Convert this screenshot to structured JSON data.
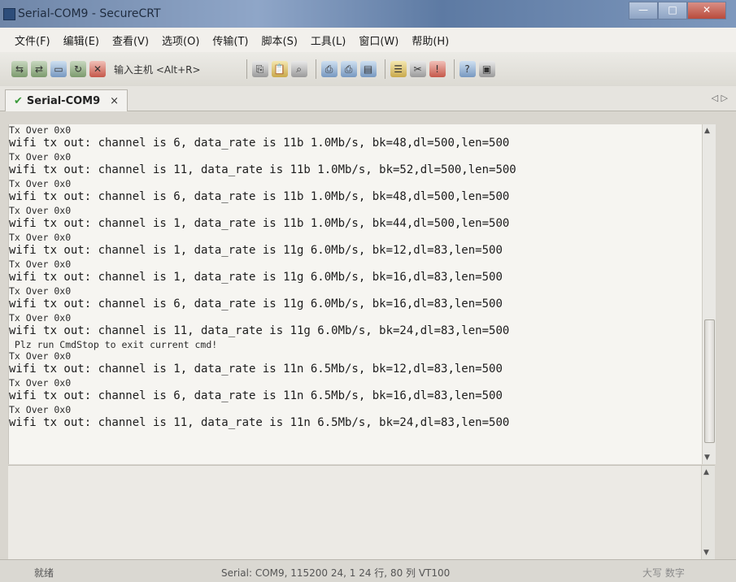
{
  "window": {
    "title": "Serial-COM9 - SecureCRT",
    "buttons": [
      "—",
      "□",
      "✕"
    ]
  },
  "menu": [
    "文件(F)",
    "编辑(E)",
    "查看(V)",
    "选项(O)",
    "传输(T)",
    "脚本(S)",
    "工具(L)",
    "窗口(W)",
    "帮助(H)"
  ],
  "toolbar": {
    "quick_connect": "输入主机 <Alt+R>",
    "icons_left": [
      "connect-icon",
      "quick-connect-icon",
      "connect-tab-icon",
      "reconnect-icon",
      "disconnect-icon"
    ],
    "icons_right": [
      "copy-icon",
      "paste-icon",
      "find-icon",
      "print-icon",
      "print-setup-icon",
      "log-icon",
      "session-options-icon",
      "keymap-icon",
      "tips-icon",
      "help-icon",
      "terminal-icon"
    ]
  },
  "tab": {
    "label": "Serial-COM9",
    "close": "×",
    "arrows": "◁ ▷"
  },
  "terminal": {
    "lines": [
      {
        "t": "Tx Over 0x0",
        "k": "small"
      },
      {
        "t": "wifi tx out: channel is 6, data_rate is 11b 1.0Mb/s, bk=48,dl=500,len=500",
        "k": "big"
      },
      {
        "t": "Tx Over 0x0",
        "k": "small"
      },
      {
        "t": "wifi tx out: channel is 11, data_rate is 11b 1.0Mb/s, bk=52,dl=500,len=500",
        "k": "big"
      },
      {
        "t": "Tx Over 0x0",
        "k": "small"
      },
      {
        "t": "wifi tx out: channel is 6, data_rate is 11b 1.0Mb/s, bk=48,dl=500,len=500",
        "k": "big"
      },
      {
        "t": "Tx Over 0x0",
        "k": "small"
      },
      {
        "t": "wifi tx out: channel is 1, data_rate is 11b 1.0Mb/s, bk=44,dl=500,len=500",
        "k": "big"
      },
      {
        "t": "Tx Over 0x0",
        "k": "small"
      },
      {
        "t": "wifi tx out: channel is 1, data_rate is 11g 6.0Mb/s, bk=12,dl=83,len=500",
        "k": "big"
      },
      {
        "t": "Tx Over 0x0",
        "k": "small"
      },
      {
        "t": "wifi tx out: channel is 1, data_rate is 11g 6.0Mb/s, bk=16,dl=83,len=500",
        "k": "big"
      },
      {
        "t": "Tx Over 0x0",
        "k": "small"
      },
      {
        "t": "wifi tx out: channel is 6, data_rate is 11g 6.0Mb/s, bk=16,dl=83,len=500",
        "k": "big"
      },
      {
        "t": "Tx Over 0x0",
        "k": "small"
      },
      {
        "t": "wifi tx out: channel is 11, data_rate is 11g 6.0Mb/s, bk=24,dl=83,len=500",
        "k": "big"
      },
      {
        "t": " Plz run CmdStop to exit current cmd!",
        "k": "small"
      },
      {
        "t": "Tx Over 0x0",
        "k": "small"
      },
      {
        "t": "wifi tx out: channel is 1, data_rate is 11n 6.5Mb/s, bk=12,dl=83,len=500",
        "k": "big"
      },
      {
        "t": "Tx Over 0x0",
        "k": "small"
      },
      {
        "t": "wifi tx out: channel is 6, data_rate is 11n 6.5Mb/s, bk=16,dl=83,len=500",
        "k": "big"
      },
      {
        "t": "Tx Over 0x0",
        "k": "small"
      },
      {
        "t": "wifi tx out: channel is 11, data_rate is 11n 6.5Mb/s, bk=24,dl=83,len=500",
        "k": "big"
      }
    ]
  },
  "status": {
    "ready": "就绪",
    "session": "Serial: COM9, 115200   24,  1   24 行, 80 列  VT100",
    "right": "大写 数字"
  }
}
